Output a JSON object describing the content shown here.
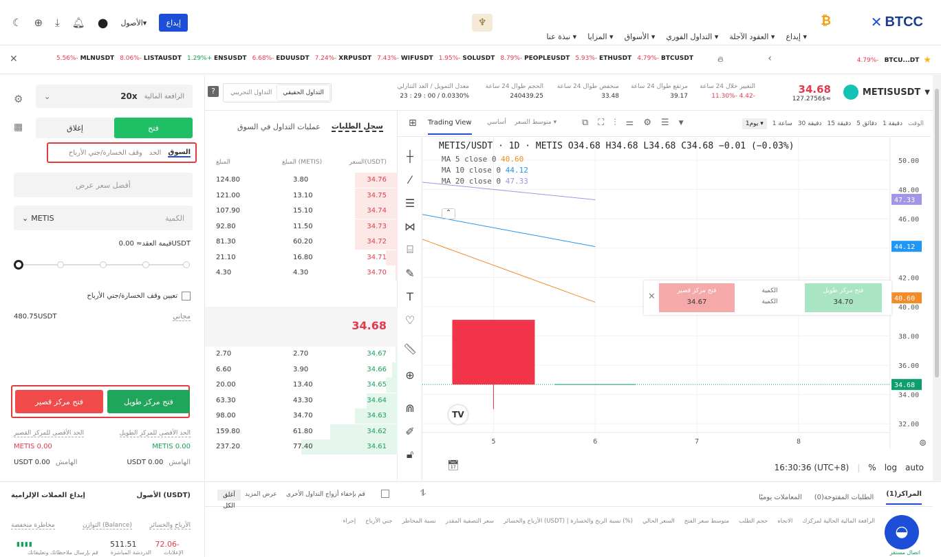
{
  "header": {
    "logo": "BTCC",
    "nav": [
      "إيداع ▾",
      "العقود الآجلة ▾",
      "التداول الفوري ▾",
      "الأسواق ▾",
      "المزايا ▾",
      "نبذة عنا ▾"
    ],
    "deposit_button": "إيداع",
    "assets_menu": "الأصول▾"
  },
  "ticker": {
    "items": [
      {
        "sym": "BTCUSDT",
        "chg": "4.79%-"
      },
      {
        "sym": "ETHUSDT",
        "chg": "5.93%-"
      },
      {
        "sym": "PEOPLEUSDT",
        "chg": "8.79%-"
      },
      {
        "sym": "SOLUSDT",
        "chg": "1.95%-"
      },
      {
        "sym": "WIFUSDT",
        "chg": "7.43%-"
      },
      {
        "sym": "XRPUSDT",
        "chg": "7.24%-"
      },
      {
        "sym": "EDUUSDT",
        "chg": "6.68%-"
      },
      {
        "sym": "ENSUSDT",
        "chg": "1.29%+"
      },
      {
        "sym": "LISTAUSDT",
        "chg": "8.06%-"
      },
      {
        "sym": "MLNUSDT",
        "chg": "5.56%-"
      }
    ],
    "right_item": {
      "sym": "BTCU...DT",
      "chg": "4.79%-"
    }
  },
  "market": {
    "symbol": "METISUSDT",
    "price": "34.68",
    "price_sub": "127.2756$≈",
    "change_label": "التغيير خلال 24 ساعة",
    "change_value": "11.30%- 4.42-",
    "high_label": "مرتفع طوال 24 ساعة",
    "high_value": "39.17",
    "low_label": "منخفض طوال 24 ساعة",
    "low_value": "33.48",
    "vol_label": "الحجم طوال 24 ساعة",
    "vol_value": "240439.25",
    "funding_label": "معدل التمويل / العد التنازلي",
    "funding_value": "23 : 29 : 00 / 0.0330%",
    "real_trade": "التداول الحقيقي",
    "demo_trade": "التداول التجريبي"
  },
  "order_form": {
    "leverage_label": "الرافعة المالية",
    "leverage_value": "20x",
    "open_tab": "فتح",
    "close_tab": "إغلاق",
    "type_market": "السوق",
    "type_limit": "الحد",
    "type_sltp": "وقف الخسارة/جني الأرباح",
    "best_price": "أفضل سعر عرض",
    "qty_label": "الكمية",
    "qty_unit": "METIS",
    "contract_value": "قيمة العقد≈ 0.00USDT",
    "sltp_checkbox": "تعيين وقف الخسارة/جني الأرباح",
    "free_label": "مجاني",
    "free_value": "480.75USDT",
    "long_button": "فتح مركز طويل",
    "short_button": "فتح مركز قصير",
    "max_long_label": "الحد الأقصى للمركز الطويل",
    "max_long_value": "METIS 0.00",
    "max_short_label": "الحد الأقصى للمركز القصير",
    "max_short_value": "METIS 0.00",
    "margin_label_l": "الهامش",
    "margin_value_l": "USDT 0.00",
    "margin_label_s": "الهامش",
    "margin_value_s": "USDT 0.00"
  },
  "orderbook": {
    "tab_book": "سجل الطلبات",
    "tab_trades": "عمليات التداول في السوق",
    "col_price": "السعر(USDT)",
    "col_qty": "المبلغ (METIS)",
    "col_total": "المبلغ",
    "asks": [
      {
        "price": "34.76",
        "qty": "3.80",
        "total": "124.80",
        "depth": 0.22
      },
      {
        "price": "34.75",
        "qty": "13.10",
        "total": "121.00",
        "depth": 0.22
      },
      {
        "price": "34.74",
        "qty": "15.10",
        "total": "107.90",
        "depth": 0.22
      },
      {
        "price": "34.73",
        "qty": "11.50",
        "total": "92.80",
        "depth": 0.22
      },
      {
        "price": "34.72",
        "qty": "60.20",
        "total": "81.30",
        "depth": 0.22
      },
      {
        "price": "34.71",
        "qty": "16.80",
        "total": "21.10",
        "depth": 0.06
      },
      {
        "price": "34.70",
        "qty": "4.30",
        "total": "4.30",
        "depth": 0.01
      }
    ],
    "mid_price": "34.68",
    "bids": [
      {
        "price": "34.67",
        "qty": "2.70",
        "total": "2.70",
        "depth": 0.01
      },
      {
        "price": "34.66",
        "qty": "3.90",
        "total": "6.60",
        "depth": 0.03
      },
      {
        "price": "34.65",
        "qty": "13.40",
        "total": "20.00",
        "depth": 0.06
      },
      {
        "price": "34.64",
        "qty": "43.30",
        "total": "63.30",
        "depth": 0.16
      },
      {
        "price": "34.63",
        "qty": "34.70",
        "total": "98.00",
        "depth": 0.22
      },
      {
        "price": "34.62",
        "qty": "61.80",
        "total": "159.80",
        "depth": 0.35
      },
      {
        "price": "34.61",
        "qty": "77.40",
        "total": "237.20",
        "depth": 0.5
      }
    ]
  },
  "chart_toolbar": {
    "time_label": "الوقت",
    "intervals": [
      "1 دقيقة",
      "5 دقائق",
      "15 دقيقة",
      "30 دقيقة",
      "1 ساعة",
      "1يوم ▾"
    ],
    "ma_menu": "متوسط السعر ▾",
    "basic": "أساسي",
    "tradingview": "Trading View"
  },
  "chart_data": {
    "type": "line",
    "title": "METIS/USDT · 1D · METIS  O34.68 H34.68 L34.68 C34.68 −0.01 (−0.03%)",
    "legend": [
      {
        "name": "MA 5 close 0",
        "value": "40.60",
        "color": "#f28c28"
      },
      {
        "name": "MA 10 close 0",
        "value": "44.12",
        "color": "#2196f3"
      },
      {
        "name": "MA 20 close 0",
        "value": "47.33",
        "color": "#a394e6"
      }
    ],
    "x_ticks": [
      "5",
      "6",
      "7",
      "8"
    ],
    "y_ticks": [
      "50.00",
      "48.00",
      "46.00",
      "44.00",
      "42.00",
      "40.00",
      "38.00",
      "36.00",
      "34.00",
      "32.00"
    ],
    "ylim": [
      31.4,
      51.6
    ],
    "xlim": [
      4.3,
      8.9
    ],
    "series": [
      {
        "name": "MA 5 close 0",
        "color": "#f28c28",
        "x": [
          4.3,
          6.0
        ],
        "y": [
          44.6,
          40.3
        ]
      },
      {
        "name": "MA 10 close 0",
        "color": "#2196f3",
        "x": [
          4.3,
          6.0
        ],
        "y": [
          46.3,
          44.1
        ]
      },
      {
        "name": "MA 20 close 0",
        "color": "#a394e6",
        "x": [
          4.3,
          6.0
        ],
        "y": [
          48.5,
          47.3
        ]
      }
    ],
    "candle": {
      "x": 5,
      "open": 39.1,
      "close": 34.68,
      "high": 39.1,
      "low": 33.0
    },
    "last_price_line": 34.68,
    "price_tags": [
      {
        "value": "47.33",
        "color": "#a394e6"
      },
      {
        "value": "44.12",
        "color": "#2196f3"
      },
      {
        "value": "40.60",
        "color": "#f28c28"
      },
      {
        "value": "34.68",
        "color": "#0e9e6e"
      }
    ],
    "time_display": "16:30:36 (UTC+8)",
    "scale_opts": [
      "%",
      "log",
      "auto"
    ],
    "quick_trade": {
      "short_label": "فتح مركز قصير",
      "short_price": "34.67",
      "qty_label": "الكمية",
      "qty_value": "الكمية",
      "long_label": "فتح مركز طويل",
      "long_price": "34.70"
    }
  },
  "bottom": {
    "tabs": [
      "المراكز(1)",
      "الطلبات المفتوحة(0)",
      "المعاملات يوميًا"
    ],
    "hide_pairs": "قم بإخفاء أزواج التداول الأخرى",
    "show_more": "عرض المزيد",
    "close_all": "أغلق الكل",
    "columns": [
      "الرافعة المالية الحالية لمركزك",
      "الاتجاه",
      "حجم الطلب",
      "متوسط سعر الفتح",
      "السعر الحالي",
      "الأرباح والخسائر (USDT) | نسبة الربح والخسارة (%)",
      "سعر التصفية المقدر",
      "نسبة المخاطر",
      "جني الأرباح",
      "إجراء"
    ],
    "assets_title": "الأصول (USDT)",
    "deposit_crypto": "إيداع العملات الإلزامية",
    "pnl_label": "الأرباح والخسائر",
    "pnl_value": "72.06-",
    "balance_label": "التوازن (Balance)",
    "balance_value": "511.51",
    "risk_label": "مخاطرة منخفضة",
    "footer1": "الإعلانات",
    "footer2": "الدردشة المباشرة",
    "footer3": "قم بإرسال ملاحظاتك وتعليقاتك",
    "footer_green": "اتصال مستقر"
  }
}
